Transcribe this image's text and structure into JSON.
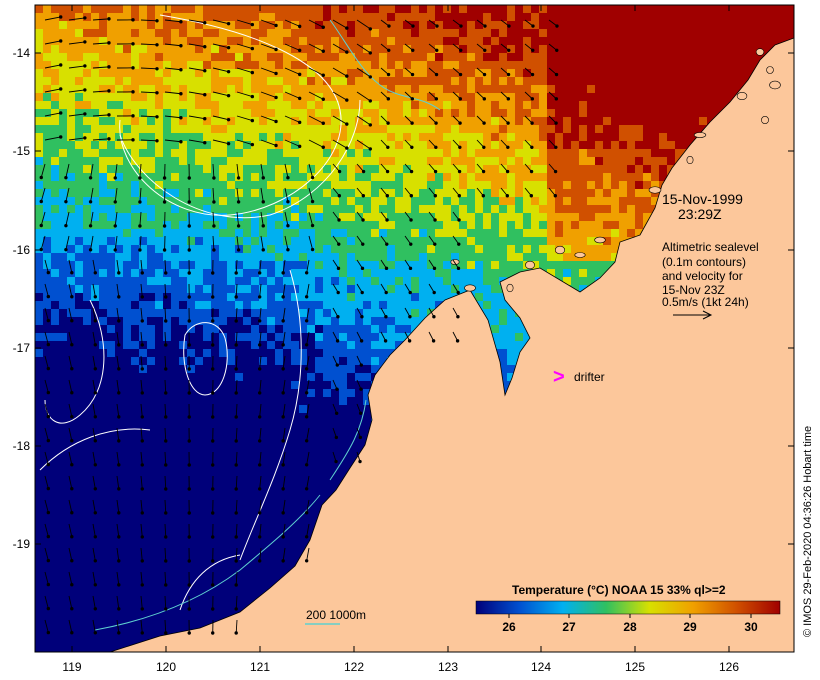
{
  "map": {
    "lat_ticks": [
      "-14",
      "-15",
      "-16",
      "-17",
      "-18",
      "-19"
    ],
    "lon_ticks": [
      "119",
      "120",
      "121",
      "122",
      "123",
      "124",
      "125",
      "126"
    ],
    "datetime": {
      "date": "15-Nov-1999",
      "time": "23:29Z"
    },
    "altimetry_note": [
      "Altimetric sealevel",
      "(0.1m contours)",
      "and velocity for",
      "15-Nov 23Z",
      "0.5m/s (1kt 24h)"
    ],
    "drifter": {
      "symbol": ">",
      "label": "drifter",
      "color": "#ff00ff"
    },
    "depth_contours_label": "200  1000m",
    "contour_color": "#5fd0d0",
    "land_color": "#fcc79b",
    "credit": "© IMOS 29-Feb-2020 04:36:26 Hobart time"
  },
  "colorbar": {
    "title": "Temperature (°C) NOAA 15 33% ql>=2",
    "ticks": [
      "26",
      "27",
      "28",
      "29",
      "30"
    ],
    "colors": [
      "#00007a",
      "#0050d0",
      "#00b0f0",
      "#30c060",
      "#d8e000",
      "#f0a000",
      "#d05000",
      "#a00000"
    ]
  }
}
